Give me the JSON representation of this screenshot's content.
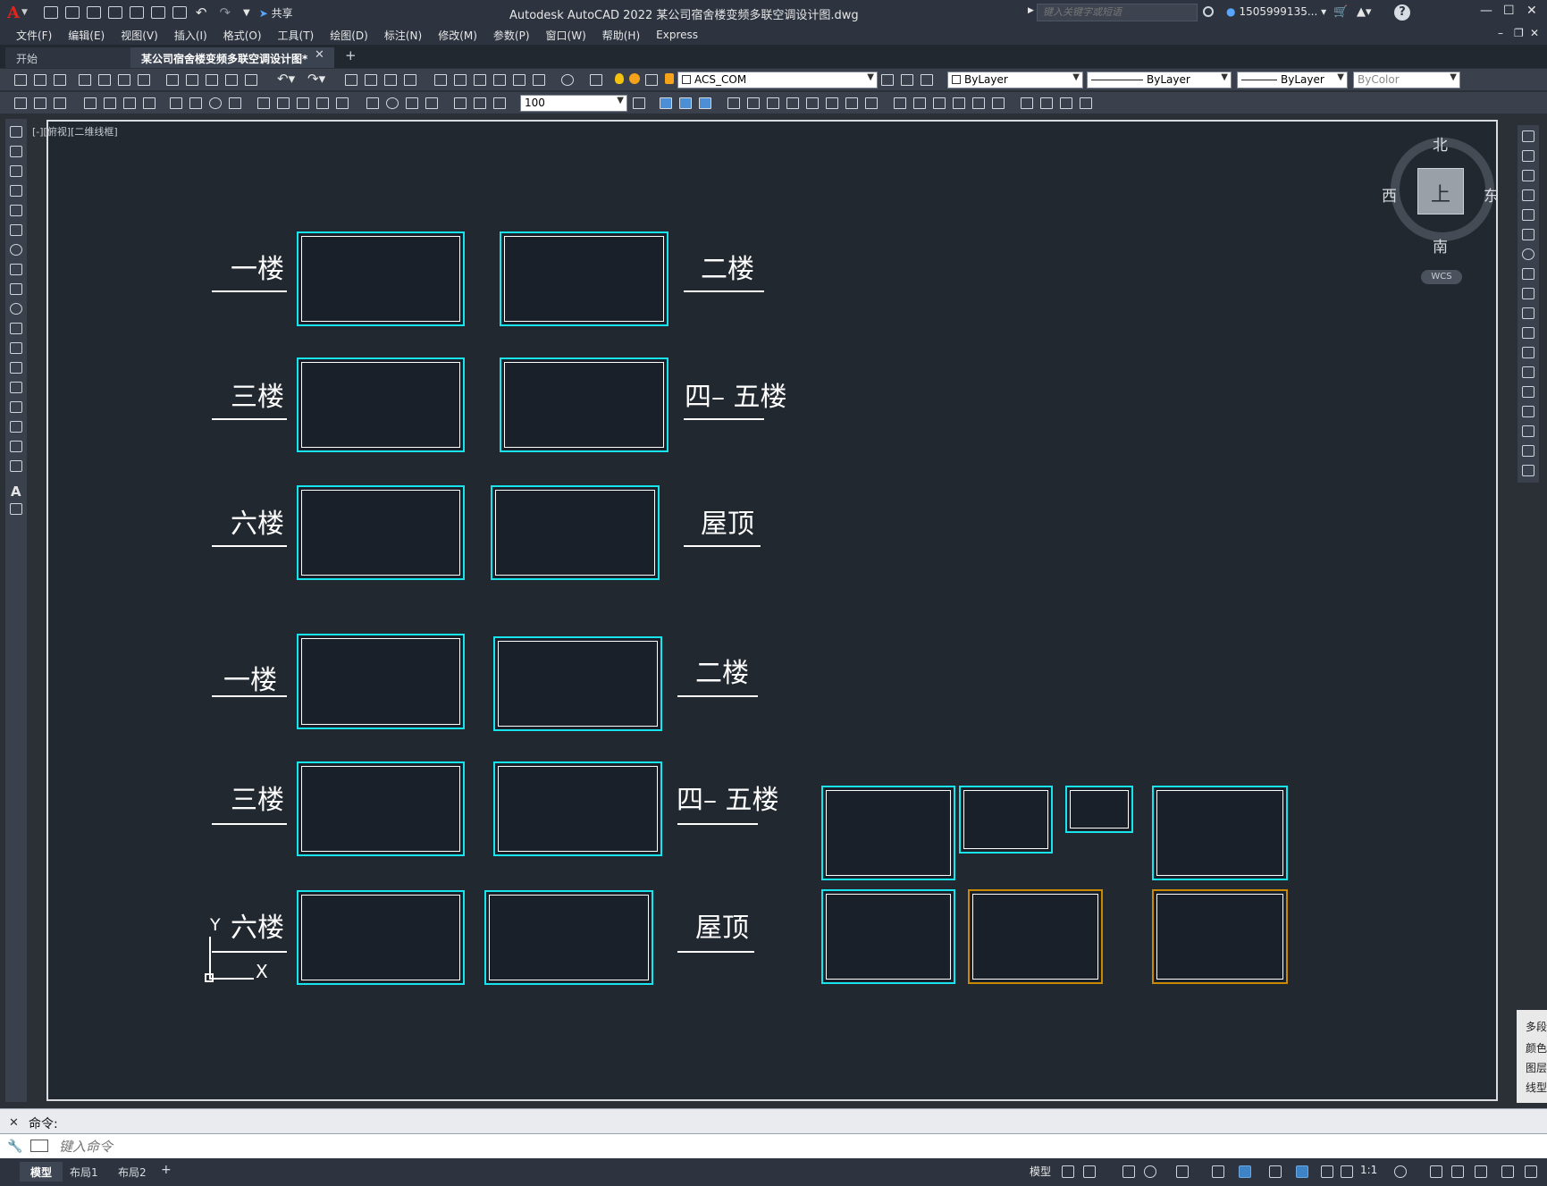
{
  "titlebar": {
    "app_title": "Autodesk AutoCAD 2022    某公司宿舍楼变频多联空调设计图.dwg",
    "share_label": "共享",
    "search_placeholder": "键入关键字或短语",
    "user": "1505999135...",
    "minimize": "—",
    "maximize": "☐",
    "close": "✕"
  },
  "menu": {
    "items": [
      "文件(F)",
      "编辑(E)",
      "视图(V)",
      "插入(I)",
      "格式(O)",
      "工具(T)",
      "绘图(D)",
      "标注(N)",
      "修改(M)",
      "参数(P)",
      "窗口(W)",
      "帮助(H)",
      "Express"
    ]
  },
  "tabs": {
    "start": "开始",
    "active": "某公司宿舍楼变频多联空调设计图*"
  },
  "toolbar": {
    "layer": "ACS_COM",
    "color": "ByLayer",
    "linetype": "ByLayer",
    "lineweight": "ByLayer",
    "plotstyle": "ByColor",
    "scale": "100"
  },
  "viewport": {
    "label": "[-][俯视][二维线框]"
  },
  "viewcube": {
    "north": "北",
    "south": "南",
    "west": "西",
    "east": "东",
    "face": "上",
    "wcs": "WCS"
  },
  "floor_labels": {
    "f1_a": "一楼",
    "f2_a": "二楼",
    "f3_a": "三楼",
    "f45_a": "四– 五楼",
    "f6_a": "六楼",
    "roof_a": "屋顶",
    "f1_b": "一楼",
    "f2_b": "二楼",
    "f3_b": "三楼",
    "f45_b": "四– 五楼",
    "f6_b": "六楼",
    "roof_b": "屋顶"
  },
  "ucs": {
    "x": "X",
    "y": "Y"
  },
  "properties_palette": {
    "title": "多段",
    "color": "颜色",
    "layer": "图层",
    "linetype": "线型"
  },
  "command": {
    "history": "命令:",
    "placeholder": "键入命令"
  },
  "layout_tabs": [
    "模型",
    "布局1",
    "布局2"
  ],
  "status": {
    "model": "模型",
    "scale": "1:1"
  }
}
